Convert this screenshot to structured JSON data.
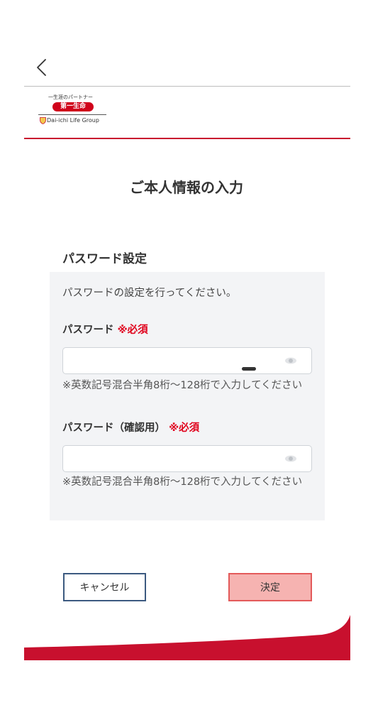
{
  "header": {
    "back_icon": "chevron-left-icon",
    "logo": {
      "tagline": "一生涯のパートナー",
      "brand": "第一生命",
      "group": "Dai-ichi Life Group"
    }
  },
  "page": {
    "title": "ご本人情報の入力"
  },
  "password_section": {
    "title": "パスワード設定",
    "description": "パスワードの設定を行ってください。",
    "password": {
      "label": "パスワード",
      "required": "※必須",
      "value": "",
      "placeholder": "",
      "hint": "※英数記号混合半角8桁～128桁で入力してください",
      "toggle_icon": "eye-icon"
    },
    "password_confirm": {
      "label": "パスワード（確認用）",
      "required": "※必須",
      "value": "",
      "placeholder": "",
      "hint": "※英数記号混合半角8桁～128桁で入力してください",
      "toggle_icon": "eye-icon"
    }
  },
  "actions": {
    "cancel_label": "キャンセル",
    "submit_label": "決定"
  },
  "colors": {
    "brand_red": "#c8102e",
    "required_red": "#e0001b",
    "panel_bg": "#f3f4f6",
    "cancel_border": "#3c5a80",
    "submit_bg": "#f6b3b1",
    "submit_border": "#e35a5a"
  }
}
